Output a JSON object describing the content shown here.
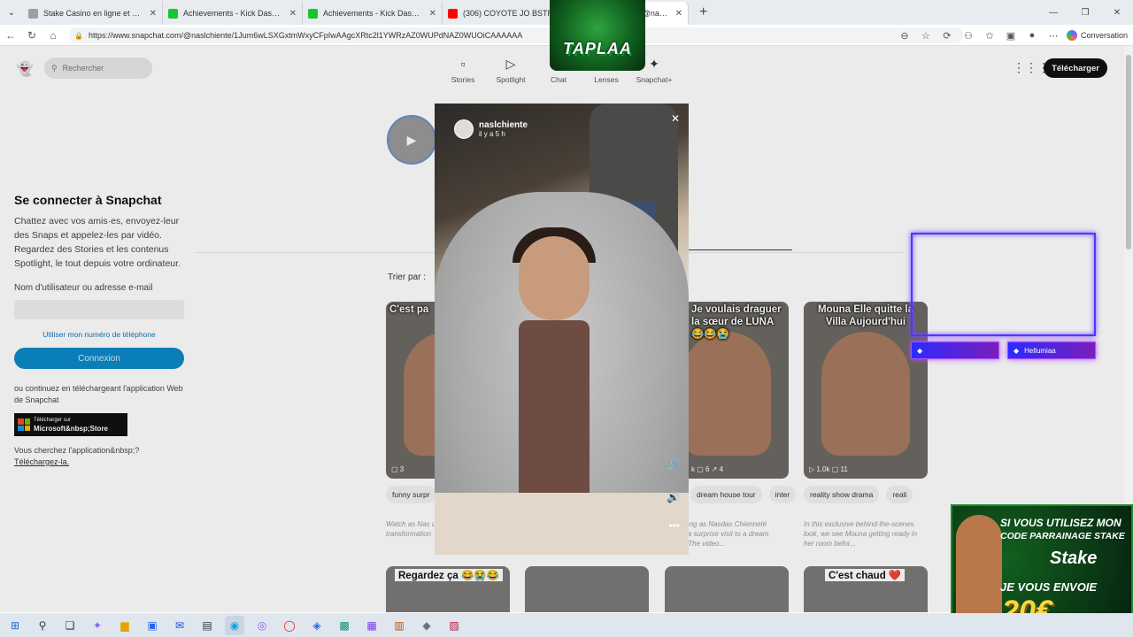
{
  "browser": {
    "tabs": [
      {
        "title": "Stake Casino en ligne et Paris Spo...",
        "color": "#9aa0a6"
      },
      {
        "title": "Achievements - Kick Dashboard",
        "color": "#19c431"
      },
      {
        "title": "Achievements - Kick Dashboard",
        "color": "#19c431"
      },
      {
        "title": "(306) COYOTE JO BSTR...",
        "color": "#ff0000"
      },
      {
        "title": "Chiennetè🎀 (@nasl...",
        "color": "#fffc00"
      }
    ],
    "url": "https://www.snapchat.com/@naslchiente/1Jum6wLSXGxtmWxyCFpIwAAgcXRtc2l1YWRzAZ0WUPdNAZ0WUOiCAAAAAA",
    "conversation_label": "Conversation"
  },
  "snapchat": {
    "search_placeholder": "Rechercher",
    "nav": [
      {
        "label": "Stories",
        "icon": "stories-icon",
        "glyph": "▫"
      },
      {
        "label": "Spotlight",
        "icon": "spotlight-icon",
        "glyph": "▷"
      },
      {
        "label": "Chat",
        "icon": "chat-icon",
        "glyph": "✉"
      },
      {
        "label": "Lenses",
        "icon": "lenses-icon",
        "glyph": "☺"
      },
      {
        "label": "Snapchat+",
        "icon": "snapchat-plus-icon",
        "glyph": "✦"
      }
    ],
    "download_label": "Télécharger",
    "login": {
      "title": "Se connecter à Snapchat",
      "description": "Chattez avec vos amis·es, envoyez-leur des Snaps et appelez-les par vidéo. Regardez des Stories et les contenus Spotlight, le tout depuis votre ordinateur.",
      "username_label": "Nom d'utilisateur ou adresse e-mail",
      "phone_link": "Utiliser mon numéro de téléphone",
      "connect_label": "Connexion",
      "or_text": "ou continuez en téléchargeant l'application Web de Snapchat",
      "store_small": "Télécharger sur",
      "store_big": "Microsoft&nbsp;Store",
      "find_text": "Vous cherchez l'application&nbsp;?",
      "find_link": "Téléchargez-la."
    },
    "sort_label": "Trier par :",
    "cards": [
      {
        "caption": "C'est pa",
        "stats": "▢ 3",
        "tags": [
          "funny surpr"
        ],
        "blurb": "Watch as Nas unveils his inc transformation"
      },
      {
        "caption": "Je voulais draguer la sœur de LUNA 😂😂😭",
        "stats": "k ▢ 6 ↗ 4",
        "tags": [
          "dream house tour",
          "inter"
        ],
        "blurb": "Join along as Nasdas Chienneté makes a surprise visit to a dream house. The video..."
      },
      {
        "caption": "Mouna Elle quitte la Villa Aujourd'hui",
        "stats": "▷ 1.0k ▢ 11",
        "tags": [
          "reality show drama",
          "reali"
        ],
        "blurb": "In this exclusive behind-the-scenes look, we see Mouna getting ready in her room befor..."
      }
    ],
    "bottom_cards": [
      {
        "caption": "Regardez ça 😂😭😂"
      },
      {
        "caption": ""
      },
      {
        "caption": ""
      },
      {
        "caption": "C'est chaud ❤️"
      }
    ]
  },
  "story": {
    "username": "naslchiente",
    "time": "il y a 5 h"
  },
  "overlays": {
    "streamer_logo": "TAPLAA",
    "neon_label": "Hellumiaa",
    "ad": {
      "line1": "SI VOUS UTILISEZ MON",
      "line2": "CODE PARRAINAGE STAKE",
      "brand": "Stake",
      "line3": "JE VOUS ENVOIE",
      "amount": "20€"
    }
  },
  "taskbar": {
    "apps": [
      "windows-start-icon",
      "search-icon",
      "task-view-icon",
      "copilot-icon",
      "file-explorer-icon",
      "store-icon",
      "mail-icon",
      "notepad-icon",
      "edge-icon",
      "chrome-icon",
      "opera-icon",
      "app-icon",
      "app-icon",
      "app-icon",
      "app-icon",
      "app-icon",
      "app-icon"
    ]
  }
}
